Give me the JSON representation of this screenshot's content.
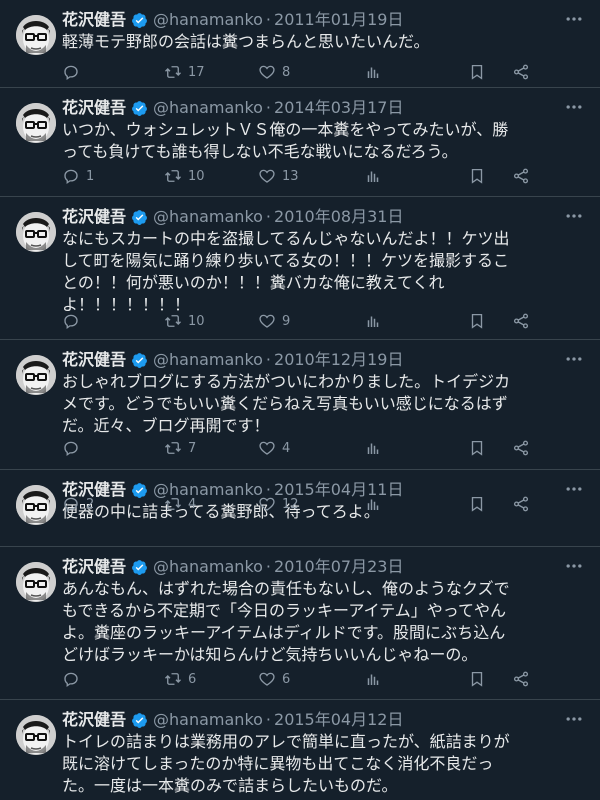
{
  "tweets": [
    {
      "name": "花沢健吾",
      "handle": "@hanamanko",
      "sep": "·",
      "date": "2011年01月19日",
      "lines": [
        "軽薄モテ野郎の会話は糞つまらんと思いたいんだ。"
      ],
      "reply": "",
      "retweet": "17",
      "like": "8",
      "icons": {
        "verified": "verified-badge-icon",
        "more": "more-icon",
        "reply": "reply-icon",
        "retweet": "retweet-icon",
        "like": "like-icon",
        "views": "views-icon",
        "bookmark": "bookmark-icon",
        "share": "share-icon"
      }
    },
    {
      "name": "花沢健吾",
      "handle": "@hanamanko",
      "sep": "·",
      "date": "2014年03月17日",
      "lines": [
        "いつか、ウォシュレットＶＳ俺の一本糞をやってみたいが、勝",
        "っても負けても誰も得しない不毛な戦いになるだろう。"
      ],
      "reply": "1",
      "retweet": "10",
      "like": "13"
    },
    {
      "name": "花沢健吾",
      "handle": "@hanamanko",
      "sep": "·",
      "date": "2010年08月31日",
      "lines": [
        "なにもスカートの中を盗撮してるんじゃないんだよ！！ケツ出",
        "して町を陽気に踊り練り歩いてる女の！！！ケツを撮影するこ",
        "との！！何が悪いのか！！！糞バカな俺に教えてくれ",
        "よ！！！！！！！"
      ],
      "reply": "",
      "retweet": "10",
      "like": "9"
    },
    {
      "name": "花沢健吾",
      "handle": "@hanamanko",
      "sep": "·",
      "date": "2010年12月19日",
      "lines": [
        "おしゃれブログにする方法がついにわかりました。トイデジカ",
        "メです。どうでもいい糞くだらねえ写真もいい感じになるはず",
        "だ。近々、ブログ再開です！"
      ],
      "reply": "",
      "retweet": "7",
      "like": "4"
    },
    {
      "name": "花沢健吾",
      "handle": "@hanamanko",
      "sep": "·",
      "date": "2015年04月11日",
      "lines": [
        "便器の中に詰まってる糞野郎、待ってろよ。"
      ],
      "reply": "2",
      "retweet": "4",
      "like": "12"
    },
    {
      "name": "花沢健吾",
      "handle": "@hanamanko",
      "sep": "·",
      "date": "2010年07月23日",
      "lines": [
        "あんなもん、はずれた場合の責任もないし、俺のようなクズで",
        "もできるから不定期で「今日のラッキーアイテム」やってやん",
        "よ。糞座のラッキーアイテムはディルドです。股間にぶち込ん",
        "どけばラッキーかは知らんけど気持ちいいんじゃねーの。"
      ],
      "reply": "",
      "retweet": "6",
      "like": "6"
    },
    {
      "name": "花沢健吾",
      "handle": "@hanamanko",
      "sep": "·",
      "date": "2015年04月12日",
      "lines": [
        "トイレの詰まりは業務用のアレで簡単に直ったが、紙詰まりが",
        "既に溶けてしまったのか特に異物も出てこなく消化不良だっ",
        "た。一度は一本糞のみで詰まらしたいものだ。"
      ],
      "reply": "",
      "retweet": "",
      "like": ""
    }
  ],
  "colors": {
    "background": "#15202b",
    "text": "#e7e9ea",
    "secondary": "#8b98a5",
    "verified": "#1d9bf0",
    "divider": "#38444d"
  }
}
